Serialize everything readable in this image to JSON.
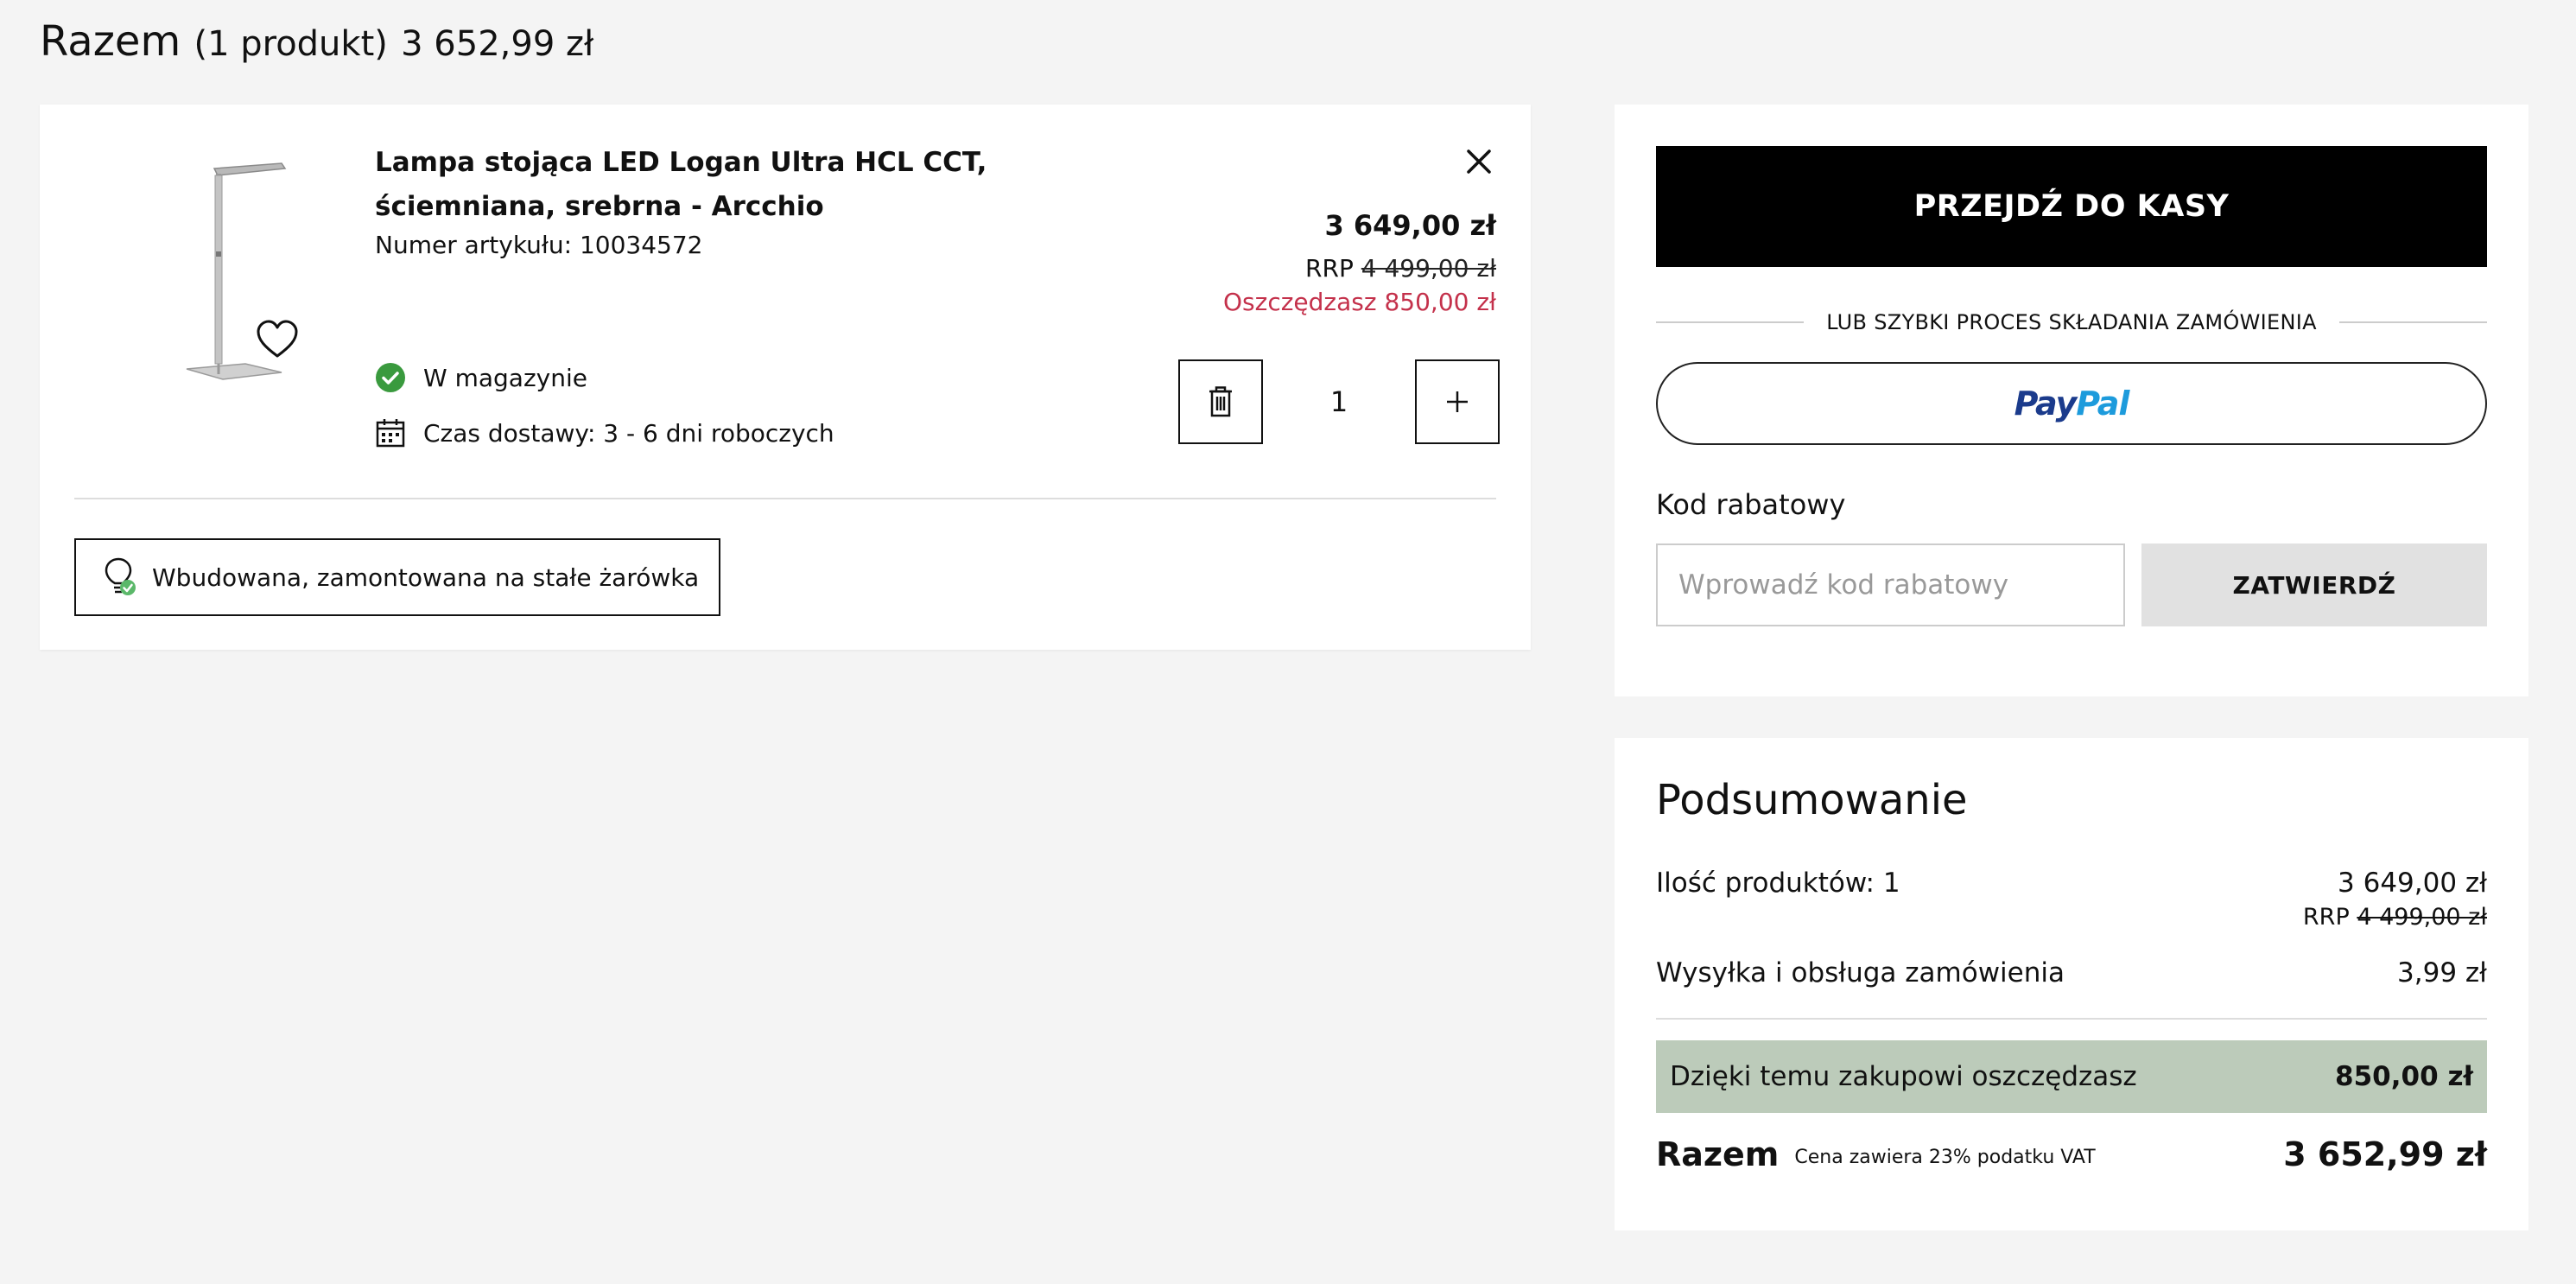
{
  "header": {
    "title": "Razem",
    "count": "(1 produkt)",
    "total": "3 652,99 zł"
  },
  "product": {
    "name": "Lampa stojąca LED Logan Ultra HCL CCT, ściemniana, srebrna - Arcchio",
    "article_number": "Numer artykułu: 10034572",
    "price": "3 649,00 zł",
    "rrp_label": "RRP",
    "rrp_price": "4 499,00 zł",
    "savings": "Oszczędzasz 850,00 zł",
    "stock": "W magazynie",
    "delivery": "Czas dostawy: 3 - 6 dni roboczych",
    "quantity": "1",
    "feature": "Wbudowana, zamontowana na stałe żarówka",
    "icons": {
      "favorite": "heart-icon",
      "remove": "close-icon",
      "delete": "trash-icon",
      "increase": "plus-icon",
      "stock": "check-circle-icon",
      "delivery": "calendar-icon",
      "feature": "bulb-icon"
    }
  },
  "checkout": {
    "button": "PRZEJDŹ DO KASY",
    "or_text": "LUB SZYBKI PROCES SKŁADANIA ZAMÓWIENIA",
    "paypal_a": "Pay",
    "paypal_b": "Pal",
    "coupon_label": "Kod rabatowy",
    "coupon_placeholder": "Wprowadź kod rabatowy",
    "coupon_value": "",
    "coupon_button": "ZATWIERDŹ"
  },
  "summary": {
    "title": "Podsumowanie",
    "products_label": "Ilość produktów: 1",
    "products_value": "3 649,00 zł",
    "rrp_label": "RRP",
    "rrp_value": "4 499,00 zł",
    "shipping_label": "Wysyłka i obsługa zamówienia",
    "shipping_value": "3,99 zł",
    "savings_label": "Dzięki temu zakupowi oszczędzasz",
    "savings_value": "850,00 zł",
    "total_label": "Razem",
    "vat_note": "Cena zawiera 23% podatku VAT",
    "total_value": "3 652,99 zł"
  },
  "colors": {
    "background": "#f4f4f4",
    "savings_text": "#c4314b",
    "savings_band": "#bccbba",
    "in_stock": "#3a9a3e",
    "paypal_dark": "#1b3b8c",
    "paypal_light": "#1d9bdc"
  }
}
